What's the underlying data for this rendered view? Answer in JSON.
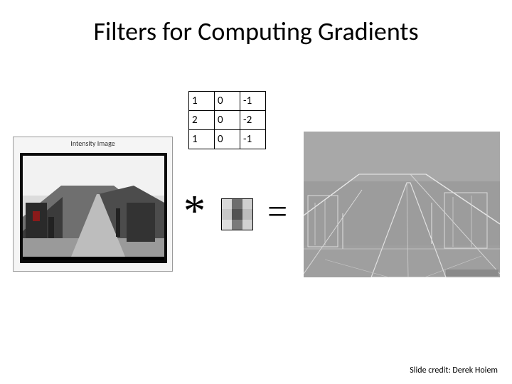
{
  "title": "Filters for Computing Gradients",
  "kernel": {
    "rows": [
      [
        "1",
        "0",
        "-1"
      ],
      [
        "2",
        "0",
        "-2"
      ],
      [
        "1",
        "0",
        "-1"
      ]
    ]
  },
  "input_panel": {
    "caption": "Intensity Image"
  },
  "symbols": {
    "convolve": "*",
    "equals": "="
  },
  "credit": "Slide credit: Derek Hoiem",
  "mini_colors": [
    "#d8d8d8",
    "#6e6e6e",
    "#cfcfcf",
    "#c7c7c7",
    "#535353",
    "#bcbcbc",
    "#dedede",
    "#7a7a7a",
    "#d2d2d2"
  ]
}
